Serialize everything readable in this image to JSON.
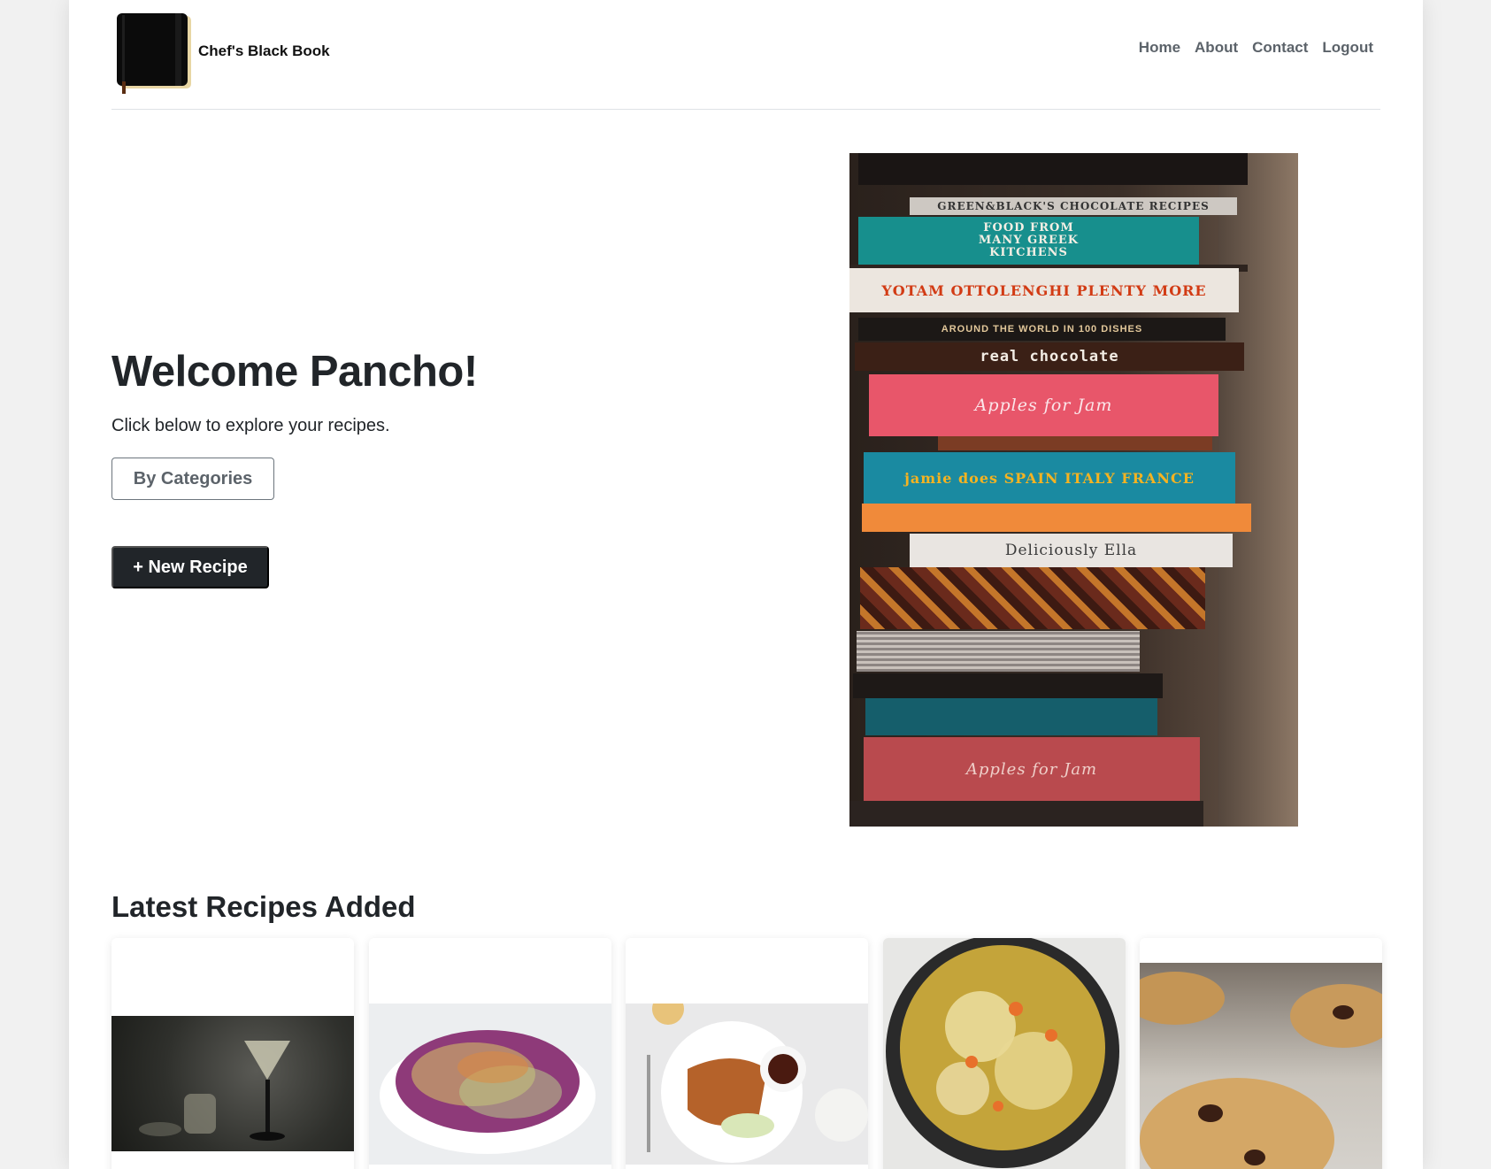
{
  "brand": {
    "name": "Chef's Black Book",
    "logo_icon": "notebook-icon"
  },
  "nav": {
    "items": [
      {
        "label": "Home"
      },
      {
        "label": "About"
      },
      {
        "label": "Contact"
      },
      {
        "label": "Logout"
      }
    ]
  },
  "hero": {
    "title": "Welcome Pancho!",
    "subtitle": "Click below to explore your recipes.",
    "categories_button": "By Categories",
    "new_recipe_button": "+ New Recipe",
    "book_spines": [
      "GREEN&BLACK'S CHOCOLATE RECIPES",
      "FOOD FROM MANY GREEK KITCHENS",
      "YOTAM OTTOLENGHI   PLENTY MORE",
      "AROUND THE WORLD IN 100 DISHES",
      "real chocolate",
      "Apples for Jam",
      "jamie does   SPAIN ITALY FRANCE",
      "Deliciously Ella",
      "Apples for Jam"
    ]
  },
  "latest": {
    "title": "Latest Recipes Added",
    "cards": [
      {
        "photo": "martini-photo"
      },
      {
        "photo": "coleslaw-photo"
      },
      {
        "photo": "katsu-plate-photo"
      },
      {
        "photo": "noodle-soup-photo"
      },
      {
        "photo": "cookies-photo"
      }
    ]
  },
  "colors": {
    "page_bg": "#f1f1f1",
    "dark_button": "#212529",
    "nav_text": "#5c636a"
  }
}
